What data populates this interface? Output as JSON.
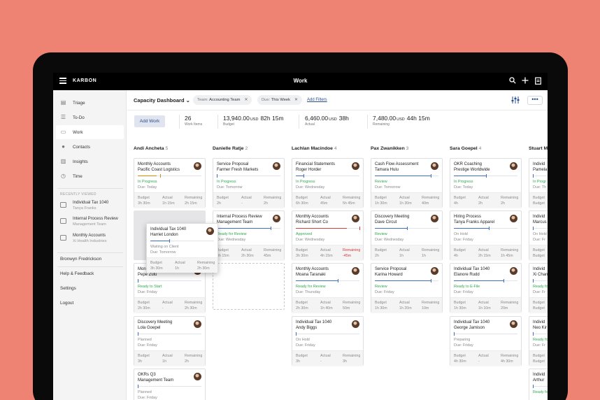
{
  "topbar": {
    "logo": "KARBON",
    "title": "Work",
    "icons": [
      "menu-icon",
      "search-icon",
      "plus-icon",
      "clipboard-icon"
    ]
  },
  "sidebar": {
    "nav": [
      {
        "label": "Triage",
        "icon": "triage-icon"
      },
      {
        "label": "To-Do",
        "icon": "todo-list-icon"
      },
      {
        "label": "Work",
        "icon": "work-icon",
        "active": true
      },
      {
        "label": "Contacts",
        "icon": "person-icon"
      },
      {
        "label": "Insights",
        "icon": "chart-icon"
      },
      {
        "label": "Time",
        "icon": "clock-icon"
      }
    ],
    "recent_header": "RECENTLY VIEWED",
    "recent": [
      {
        "title": "Individual Tax 1040",
        "sub": "Tanya Franks"
      },
      {
        "title": "Internal Process Review",
        "sub": "Management Team"
      },
      {
        "title": "Monthly Accounts",
        "sub": "Xi Health Industries"
      }
    ],
    "user": "Bronwyn Fredrickson",
    "links": [
      "Help & Feedback",
      "Settings",
      "Logout"
    ]
  },
  "toolbar": {
    "dashboard": "Capacity Dashboard",
    "filters": [
      {
        "key": "Team:",
        "value": "Accounting Team"
      },
      {
        "key": "Due:",
        "value": "This Week"
      }
    ],
    "add_filters": "Add Filters"
  },
  "stats": {
    "add_work": "Add Work",
    "items": {
      "value": "26",
      "label": "Work Items"
    },
    "budget": {
      "amount": "13,940.00",
      "currency": "USD",
      "hours": "82h 15m",
      "label": "Budget"
    },
    "actual": {
      "amount": "6,460.00",
      "currency": "USD",
      "hours": "38h",
      "label": "Actual"
    },
    "remaining": {
      "amount": "7,480.00",
      "currency": "USD",
      "hours": "44h 15m",
      "label": "Remaining"
    }
  },
  "colors": {
    "accent": "#2a4d8f",
    "bar": "#3f6fc2",
    "green": "#2fa84f",
    "orange": "#e08a00",
    "red": "#d33a3a",
    "background": "#ee8374"
  },
  "footer_labels": {
    "budget": "Budget",
    "actual": "Actual",
    "remaining": "Remaining"
  },
  "columns": [
    {
      "name": "Andi Ancheta",
      "count": "5",
      "cards": [
        {
          "t1": "Monthly Accounts",
          "t2": "Pacific Coast Logistics",
          "status": "In Progress",
          "sc": "green",
          "due": "Due: Today",
          "budget": "3h 30m",
          "actual": "1h 15m",
          "remaining": "2h 15m",
          "progress": 0.3,
          "marker": 0.35,
          "barColor": "orange"
        },
        null,
        {
          "t1": "Mon",
          "t2": "Pepe Zulu",
          "status": "Ready to Start",
          "sc": "green",
          "due": "Due: Friday",
          "budget": "2h 30m",
          "actual": "-",
          "remaining": "2h 30m",
          "progress": 0,
          "marker": 0
        },
        {
          "t1": "Discovery Meeting",
          "t2": "Lola Goepel",
          "status": "Planned",
          "sc": "gray",
          "due": "Due: Friday",
          "budget": "3h",
          "actual": "1h",
          "remaining": "2h",
          "progress": 0,
          "marker": 0
        },
        {
          "t1": "OKRs Q3",
          "t2": "Management Team",
          "status": "Planned",
          "sc": "gray",
          "due": "Due: Friday",
          "progress": 0,
          "marker": 0
        }
      ]
    },
    {
      "name": "Danielle Ratje",
      "count": "2",
      "cards": [
        {
          "t1": "Service Proposal",
          "t2": "Farmer Fresh Markets",
          "status": "In Progress",
          "sc": "green",
          "due": "Due: Tomorrow",
          "budget": "2h",
          "actual": "-",
          "remaining": "2h",
          "progress": 0,
          "marker": 0
        },
        {
          "t1": "Internal Process Review",
          "t2": "Management Team",
          "status": "Ready for Review",
          "sc": "green",
          "due": "Due: Wednesday",
          "budget": "3h 15m",
          "actual": "2h 30m",
          "remaining": "45m",
          "progress": 0.85,
          "marker": 0.85
        }
      ]
    },
    {
      "name": "Lachlan Macindoe",
      "count": "4",
      "cards": [
        {
          "t1": "Financial Statements",
          "t2": "Roger Horder",
          "status": "In Progress",
          "sc": "green",
          "due": "Due: Wednesday",
          "budget": "6h 30m",
          "actual": "45m",
          "remaining": "5h 45m",
          "progress": 0.12,
          "marker": 0.12
        },
        {
          "t1": "Monthly Accounts",
          "t2": "Richard Short Co",
          "status": "Approved",
          "sc": "green",
          "due": "Due: Wednesday",
          "budget": "3h 30m",
          "actual": "4h 15m",
          "remaining": "-45m",
          "remRed": true,
          "progress": 0.8,
          "marker": 1,
          "barColor": "red"
        },
        {
          "t1": "Monthly Accounts",
          "t2": "Moana Taranaki",
          "status": "Ready for Review",
          "sc": "green",
          "due": "Due: Thursday",
          "budget": "2h 30m",
          "actual": "1h 40m",
          "remaining": "50m",
          "progress": 0.66,
          "marker": 0.66
        },
        {
          "t1": "Individual Tax 1040",
          "t2": "Andy Biggs",
          "status": "On Hold",
          "sc": "gray",
          "due": "Due: Friday",
          "budget": "3h",
          "actual": "-",
          "remaining": "3h",
          "progress": 0,
          "marker": 0
        }
      ]
    },
    {
      "name": "Pax Zwanikken",
      "count": "3",
      "cards": [
        {
          "t1": "Cash Flow Assessment",
          "t2": "Tamara Hulu",
          "status": "Review",
          "sc": "green",
          "due": "Due: Tomorrow",
          "budget": "1h 30m",
          "actual": "1h 30m",
          "remaining": "40m",
          "progress": 0.88,
          "marker": 0.88
        },
        {
          "t1": "Discovery Meeting",
          "t2": "Dave Circut",
          "status": "Review",
          "sc": "green",
          "due": "Due: Wednesday",
          "budget": "2h",
          "actual": "1h",
          "remaining": "1h",
          "progress": 0.5,
          "marker": 0.5
        },
        {
          "t1": "Service Proposal",
          "t2": "Karina Howard",
          "status": "Review",
          "sc": "green",
          "due": "Due: Friday",
          "budget": "1h 30m",
          "actual": "1h 20m",
          "remaining": "10m",
          "progress": 0.88,
          "marker": 0.88
        }
      ]
    },
    {
      "name": "Sara Goepel",
      "count": "4",
      "cards": [
        {
          "t1": "OKR Coaching",
          "t2": "Prestige Worldwide",
          "status": "In Progress",
          "sc": "green",
          "due": "Due: Today",
          "budget": "4h",
          "actual": "2h",
          "remaining": "2h",
          "progress": 0.5,
          "marker": 0.5
        },
        {
          "t1": "Hiring Process",
          "t2": "Tanya Franks Apparel",
          "status": "On Hold",
          "sc": "gray",
          "due": "Due: Friday",
          "budget": "4h",
          "actual": "2h 15m",
          "remaining": "1h 45m",
          "progress": 0.55,
          "marker": 0.55
        },
        {
          "t1": "Individual Tax 1040",
          "t2": "Elanore Rudd",
          "status": "Ready to E-File",
          "sc": "green",
          "due": "Due: Friday",
          "budget": "1h 30m",
          "actual": "1h 10m",
          "remaining": "20m",
          "progress": 0.78,
          "marker": 0.78
        },
        {
          "t1": "Individual Tax 1040",
          "t2": "George Jamison",
          "status": "Preparing",
          "sc": "gray",
          "due": "Due: Friday",
          "budget": "4h 30m",
          "actual": "-",
          "remaining": "4h 30m",
          "progress": 0,
          "marker": 0
        }
      ]
    },
    {
      "name": "Stuart M",
      "count": "",
      "cards": [
        {
          "t1": "Individ",
          "t2": "Pamela",
          "status": "In Progr",
          "sc": "green",
          "due": "Due: Th",
          "budget": "Budget",
          "actual": "",
          "remaining": "",
          "progress": 0,
          "marker": 0
        },
        {
          "t1": "Individ",
          "t2": "Marcus",
          "status": "On Hold",
          "sc": "gray",
          "due": "Due: Fr",
          "budget": "Budget",
          "progress": 0,
          "marker": 0
        },
        {
          "t1": "Individ",
          "t2": "Xi Chan",
          "status": "Ready fo",
          "sc": "green",
          "due": "Due: Fr",
          "budget": "Budget",
          "progress": 0,
          "marker": 0
        },
        {
          "t1": "Individ",
          "t2": "Neo Kir",
          "status": "Ready fo",
          "sc": "green",
          "due": "Due: Fr",
          "budget": "Budget",
          "progress": 0,
          "marker": 0
        },
        {
          "t1": "Individ",
          "t2": "Arthur",
          "status": "Ready fo",
          "sc": "green",
          "due": "",
          "progress": 0,
          "marker": 0
        }
      ]
    }
  ],
  "drag_card": {
    "t1": "Individual Tax 1040",
    "t2": "Harriet London",
    "status": "Waiting on Client",
    "due": "Due: Tomorrow",
    "budget": "3h 30m",
    "actual": "1h",
    "remaining": "2h 30m",
    "progress": 0.3,
    "marker": 0.3
  }
}
